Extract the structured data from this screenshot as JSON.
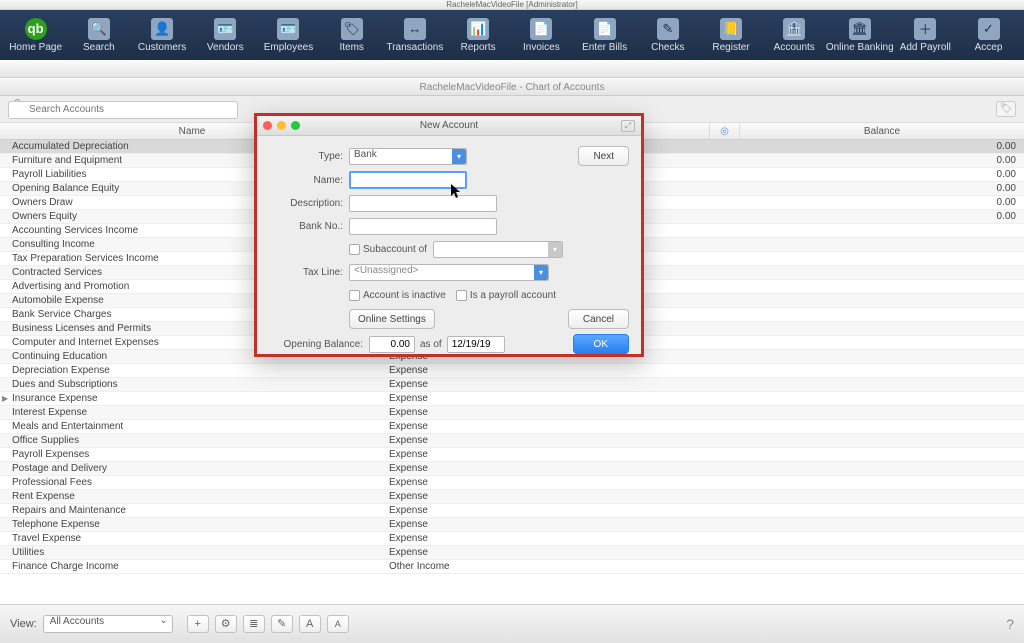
{
  "mac_title": "RacheleMacVideoFile [Administrator]",
  "toolbar": [
    {
      "label": "Home Page",
      "icon": "qb"
    },
    {
      "label": "Search",
      "icon": "🔍"
    },
    {
      "label": "Customers",
      "icon": "👤"
    },
    {
      "label": "Vendors",
      "icon": "🪪"
    },
    {
      "label": "Employees",
      "icon": "🪪"
    },
    {
      "label": "Items",
      "icon": "🏷"
    },
    {
      "label": "Transactions",
      "icon": "↔"
    },
    {
      "label": "Reports",
      "icon": "📊"
    },
    {
      "label": "Invoices",
      "icon": "📄"
    },
    {
      "label": "Enter Bills",
      "icon": "📄"
    },
    {
      "label": "Checks",
      "icon": "✎"
    },
    {
      "label": "Register",
      "icon": "📒"
    },
    {
      "label": "Accounts",
      "icon": "🏦"
    },
    {
      "label": "Online Banking",
      "icon": "🏛"
    },
    {
      "label": "Add Payroll",
      "icon": "＋"
    },
    {
      "label": "Accep",
      "icon": "✓"
    }
  ],
  "window_subtitle": "RacheleMacVideoFile - Chart of Accounts",
  "search_placeholder": "Search Accounts",
  "columns": {
    "name": "Name",
    "type": "",
    "flag": "◎",
    "balance": "Balance"
  },
  "rows": [
    {
      "name": "Accumulated Depreciation",
      "type": "",
      "bal": "0.00",
      "sel": true
    },
    {
      "name": "Furniture and Equipment",
      "type": "",
      "bal": "0.00"
    },
    {
      "name": "Payroll Liabilities",
      "type": "",
      "bal": "0.00"
    },
    {
      "name": "Opening Balance Equity",
      "type": "",
      "bal": "0.00"
    },
    {
      "name": "Owners Draw",
      "type": "",
      "bal": "0.00"
    },
    {
      "name": "Owners Equity",
      "type": "",
      "bal": "0.00"
    },
    {
      "name": "Accounting Services Income",
      "type": "",
      "bal": ""
    },
    {
      "name": "Consulting Income",
      "type": "",
      "bal": ""
    },
    {
      "name": "Tax Preparation Services Income",
      "type": "",
      "bal": ""
    },
    {
      "name": "Contracted Services",
      "type": "",
      "bal": ""
    },
    {
      "name": "Advertising and Promotion",
      "type": "",
      "bal": ""
    },
    {
      "name": "Automobile Expense",
      "type": "",
      "bal": ""
    },
    {
      "name": "Bank Service Charges",
      "type": "",
      "bal": ""
    },
    {
      "name": "Business Licenses and Permits",
      "type": "",
      "bal": ""
    },
    {
      "name": "Computer and Internet Expenses",
      "type": "",
      "bal": ""
    },
    {
      "name": "Continuing Education",
      "type": "Expense",
      "bal": ""
    },
    {
      "name": "Depreciation Expense",
      "type": "Expense",
      "bal": ""
    },
    {
      "name": "Dues and Subscriptions",
      "type": "Expense",
      "bal": ""
    },
    {
      "name": "Insurance Expense",
      "type": "Expense",
      "bal": "",
      "expand": true
    },
    {
      "name": "Interest Expense",
      "type": "Expense",
      "bal": ""
    },
    {
      "name": "Meals and Entertainment",
      "type": "Expense",
      "bal": ""
    },
    {
      "name": "Office Supplies",
      "type": "Expense",
      "bal": ""
    },
    {
      "name": "Payroll Expenses",
      "type": "Expense",
      "bal": ""
    },
    {
      "name": "Postage and Delivery",
      "type": "Expense",
      "bal": ""
    },
    {
      "name": "Professional Fees",
      "type": "Expense",
      "bal": ""
    },
    {
      "name": "Rent Expense",
      "type": "Expense",
      "bal": ""
    },
    {
      "name": "Repairs and Maintenance",
      "type": "Expense",
      "bal": ""
    },
    {
      "name": "Telephone Expense",
      "type": "Expense",
      "bal": ""
    },
    {
      "name": "Travel Expense",
      "type": "Expense",
      "bal": ""
    },
    {
      "name": "Utilities",
      "type": "Expense",
      "bal": ""
    },
    {
      "name": "Finance Charge Income",
      "type": "Other Income",
      "bal": ""
    }
  ],
  "footer": {
    "view_label": "View:",
    "view_value": "All Accounts"
  },
  "dialog": {
    "title": "New Account",
    "type_label": "Type:",
    "type_value": "Bank",
    "name_label": "Name:",
    "name_value": "",
    "desc_label": "Description:",
    "desc_value": "",
    "bankno_label": "Bank No.:",
    "bankno_value": "",
    "sub_check": "Subaccount of",
    "sub_value": "",
    "taxline_label": "Tax Line:",
    "taxline_value": "<Unassigned>",
    "inactive": "Account is inactive",
    "payroll": "Is a payroll account",
    "online_settings": "Online Settings",
    "opening_label": "Opening Balance:",
    "opening_value": "0.00",
    "asof": "as of",
    "asof_date": "12/19/19",
    "next": "Next",
    "cancel": "Cancel",
    "ok": "OK"
  }
}
